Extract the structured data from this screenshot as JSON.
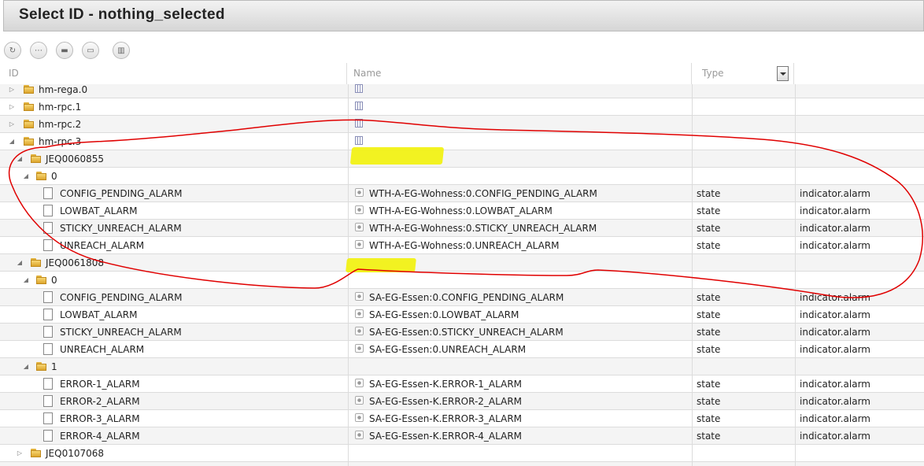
{
  "window": {
    "title": "Select ID - nothing_selected"
  },
  "toolbar": {
    "buttons": [
      {
        "name": "refresh-button",
        "glyph": "↻"
      },
      {
        "name": "collapse-button",
        "glyph": "⋯"
      },
      {
        "name": "folder-button",
        "glyph": "▬"
      },
      {
        "name": "open-folder-button",
        "glyph": "▭"
      },
      {
        "name": "columns-button",
        "glyph": "▥"
      }
    ]
  },
  "columns": {
    "id": "ID",
    "name": "Name",
    "type": "Type"
  },
  "rows": [
    {
      "id": "hm-rega.0",
      "kind": "folder",
      "level": 0,
      "toggle": "▷",
      "nameIcon": "channel",
      "name": "",
      "type": "",
      "role": ""
    },
    {
      "id": "hm-rpc.1",
      "kind": "folder",
      "level": 0,
      "toggle": "▷",
      "nameIcon": "channel",
      "name": "",
      "type": "",
      "role": ""
    },
    {
      "id": "hm-rpc.2",
      "kind": "folder",
      "level": 0,
      "toggle": "▷",
      "nameIcon": "channel",
      "name": "",
      "type": "",
      "role": ""
    },
    {
      "id": "hm-rpc.3",
      "kind": "folder",
      "level": 0,
      "toggle": "◢",
      "nameIcon": "channel",
      "name": "",
      "type": "",
      "role": ""
    },
    {
      "id": "JEQ0060855",
      "kind": "folder",
      "level": 1,
      "toggle": "◢",
      "nameIcon": "",
      "name": "",
      "type": "",
      "role": ""
    },
    {
      "id": "0",
      "kind": "folder",
      "level": 2,
      "toggle": "◢",
      "nameIcon": "",
      "name": "",
      "type": "",
      "role": ""
    },
    {
      "id": "CONFIG_PENDING_ALARM",
      "kind": "file",
      "level": 3,
      "toggle": "",
      "nameIcon": "state",
      "name": "WTH-A-EG-Wohness:0.CONFIG_PENDING_ALARM",
      "type": "state",
      "role": "indicator.alarm"
    },
    {
      "id": "LOWBAT_ALARM",
      "kind": "file",
      "level": 3,
      "toggle": "",
      "nameIcon": "state",
      "name": "WTH-A-EG-Wohness:0.LOWBAT_ALARM",
      "type": "state",
      "role": "indicator.alarm"
    },
    {
      "id": "STICKY_UNREACH_ALARM",
      "kind": "file",
      "level": 3,
      "toggle": "",
      "nameIcon": "state",
      "name": "WTH-A-EG-Wohness:0.STICKY_UNREACH_ALARM",
      "type": "state",
      "role": "indicator.alarm"
    },
    {
      "id": "UNREACH_ALARM",
      "kind": "file",
      "level": 3,
      "toggle": "",
      "nameIcon": "state",
      "name": "WTH-A-EG-Wohness:0.UNREACH_ALARM",
      "type": "state",
      "role": "indicator.alarm"
    },
    {
      "id": "JEQ0061808",
      "kind": "folder",
      "level": 1,
      "toggle": "◢",
      "nameIcon": "",
      "name": "",
      "type": "",
      "role": ""
    },
    {
      "id": "0",
      "kind": "folder",
      "level": 2,
      "toggle": "◢",
      "nameIcon": "",
      "name": "",
      "type": "",
      "role": ""
    },
    {
      "id": "CONFIG_PENDING_ALARM",
      "kind": "file",
      "level": 3,
      "toggle": "",
      "nameIcon": "state",
      "name": "SA-EG-Essen:0.CONFIG_PENDING_ALARM",
      "type": "state",
      "role": "indicator.alarm"
    },
    {
      "id": "LOWBAT_ALARM",
      "kind": "file",
      "level": 3,
      "toggle": "",
      "nameIcon": "state",
      "name": "SA-EG-Essen:0.LOWBAT_ALARM",
      "type": "state",
      "role": "indicator.alarm"
    },
    {
      "id": "STICKY_UNREACH_ALARM",
      "kind": "file",
      "level": 3,
      "toggle": "",
      "nameIcon": "state",
      "name": "SA-EG-Essen:0.STICKY_UNREACH_ALARM",
      "type": "state",
      "role": "indicator.alarm"
    },
    {
      "id": "UNREACH_ALARM",
      "kind": "file",
      "level": 3,
      "toggle": "",
      "nameIcon": "state",
      "name": "SA-EG-Essen:0.UNREACH_ALARM",
      "type": "state",
      "role": "indicator.alarm"
    },
    {
      "id": "1",
      "kind": "folder",
      "level": 2,
      "toggle": "◢",
      "nameIcon": "",
      "name": "",
      "type": "",
      "role": ""
    },
    {
      "id": "ERROR-1_ALARM",
      "kind": "file",
      "level": 3,
      "toggle": "",
      "nameIcon": "state",
      "name": "SA-EG-Essen-K.ERROR-1_ALARM",
      "type": "state",
      "role": "indicator.alarm"
    },
    {
      "id": "ERROR-2_ALARM",
      "kind": "file",
      "level": 3,
      "toggle": "",
      "nameIcon": "state",
      "name": "SA-EG-Essen-K.ERROR-2_ALARM",
      "type": "state",
      "role": "indicator.alarm"
    },
    {
      "id": "ERROR-3_ALARM",
      "kind": "file",
      "level": 3,
      "toggle": "",
      "nameIcon": "state",
      "name": "SA-EG-Essen-K.ERROR-3_ALARM",
      "type": "state",
      "role": "indicator.alarm"
    },
    {
      "id": "ERROR-4_ALARM",
      "kind": "file",
      "level": 3,
      "toggle": "",
      "nameIcon": "state",
      "name": "SA-EG-Essen-K.ERROR-4_ALARM",
      "type": "state",
      "role": "indicator.alarm"
    },
    {
      "id": "JEQ0107068",
      "kind": "folder",
      "level": 1,
      "toggle": "▷",
      "nameIcon": "",
      "name": "",
      "type": "",
      "role": ""
    },
    {
      "id": "",
      "kind": "folder",
      "level": 1,
      "toggle": "",
      "nameIcon": "",
      "name": "",
      "type": "",
      "role": ""
    }
  ],
  "annotations": {
    "stroke_color": "#e00000",
    "highlight_color": "#f2f20a"
  }
}
